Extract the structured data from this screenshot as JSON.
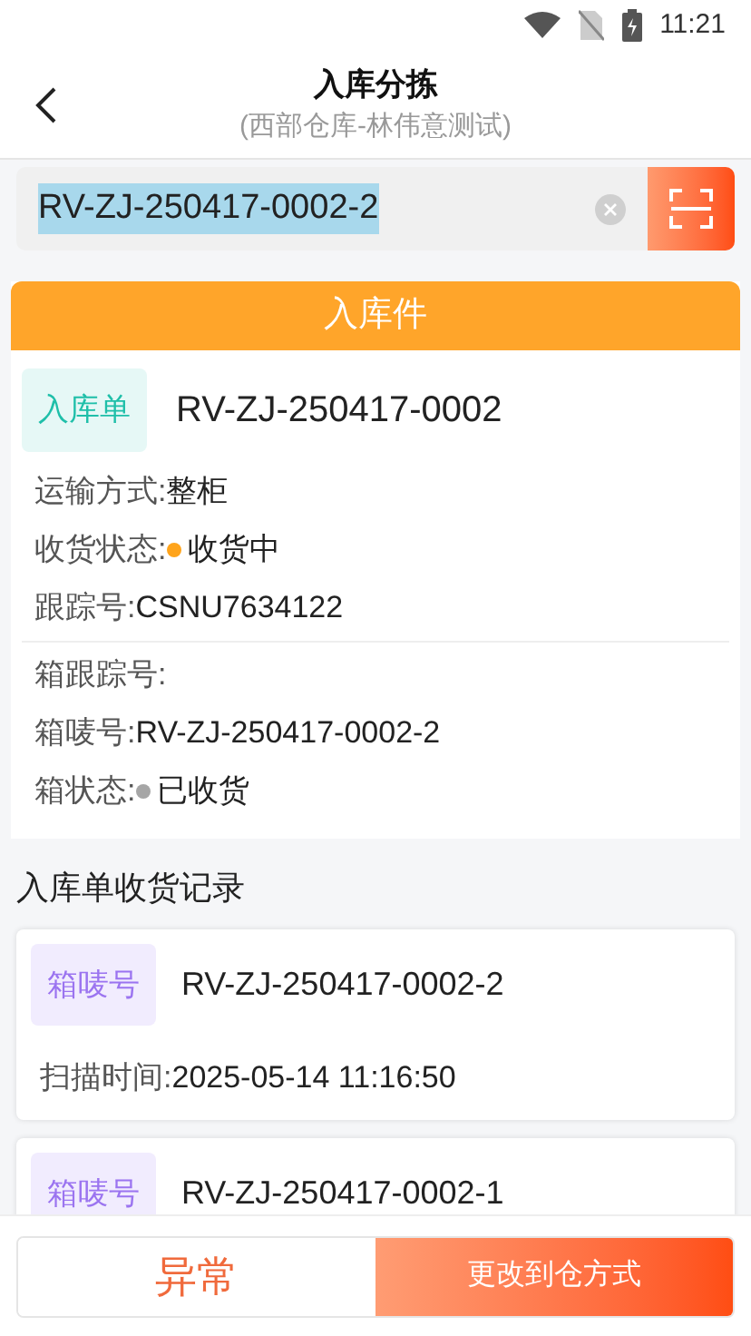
{
  "status_bar": {
    "time": "11:21"
  },
  "header": {
    "title": "入库分拣",
    "subtitle": "(西部仓库-林伟意测试)"
  },
  "search": {
    "value": "RV-ZJ-250417-0002-2",
    "selected": true
  },
  "section_bar": {
    "title": "入库件"
  },
  "order": {
    "tag": "入库单",
    "number": "RV-ZJ-250417-0002",
    "groups": [
      [
        {
          "label": "运输方式:",
          "value": "整柜"
        },
        {
          "label": "收货状态:",
          "value": "收货中",
          "color": "#ffa41b"
        },
        {
          "label": "跟踪号:",
          "value": "CSNU7634122"
        }
      ],
      [
        {
          "label": "箱跟踪号:"
        },
        {
          "label": "箱唛号:",
          "value": "RV-ZJ-250417-0002-2"
        },
        {
          "label": "箱状态:",
          "value": "已收货",
          "color": "#a6a6a6"
        }
      ]
    ]
  },
  "records": {
    "title": "入库单收货记录",
    "items": [
      {
        "tag": "箱唛号",
        "code": "RV-ZJ-250417-0002-2",
        "scan_label": "扫描时间:",
        "scan_time": "2025-05-14 11:16:50"
      },
      {
        "tag": "箱唛号",
        "code": "RV-ZJ-250417-0002-1"
      }
    ]
  },
  "buttons": {
    "secondary": "异常",
    "primary": "更改到仓方式"
  }
}
